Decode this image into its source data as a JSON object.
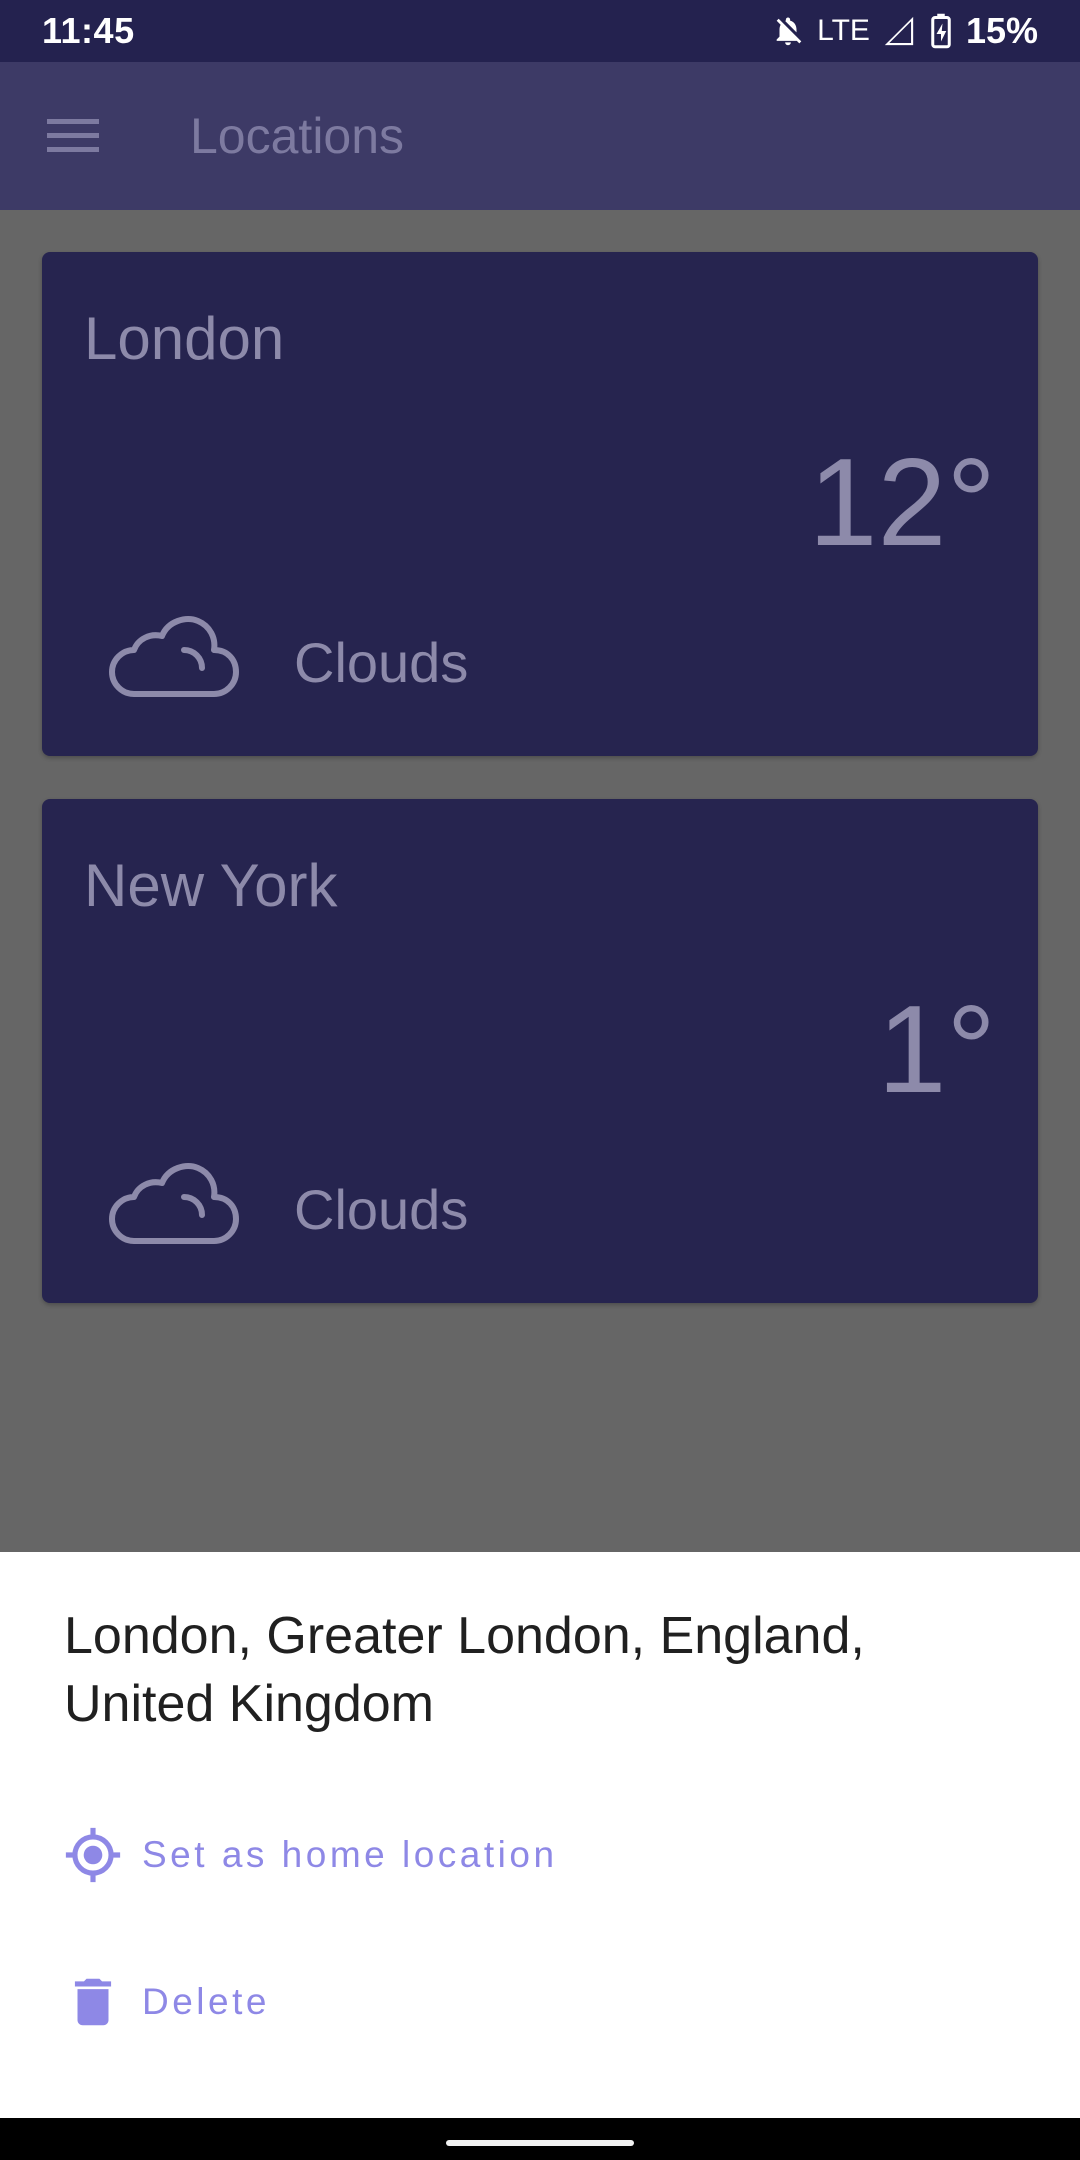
{
  "status_bar": {
    "time": "11:45",
    "network": "LTE",
    "battery": "15%",
    "icons": [
      "notifications-off-icon",
      "signal-icon",
      "battery-charging-icon"
    ]
  },
  "app_bar": {
    "title": "Locations",
    "menu_icon": "menu-icon"
  },
  "locations": [
    {
      "city": "London",
      "temperature": "12°",
      "condition": "Clouds",
      "icon": "cloud-icon"
    },
    {
      "city": "New York",
      "temperature": "1°",
      "condition": "Clouds",
      "icon": "cloud-icon"
    }
  ],
  "bottom_sheet": {
    "title": "London, Greater London, England, United Kingdom",
    "actions": [
      {
        "label": "Set as home location",
        "icon": "my-location-icon"
      },
      {
        "label": "Delete",
        "icon": "trash-icon"
      }
    ]
  },
  "colors": {
    "app_bar": "#3d3a66",
    "card": "#26244f",
    "scrim": "#666666",
    "action_accent": "#8e88e6"
  }
}
